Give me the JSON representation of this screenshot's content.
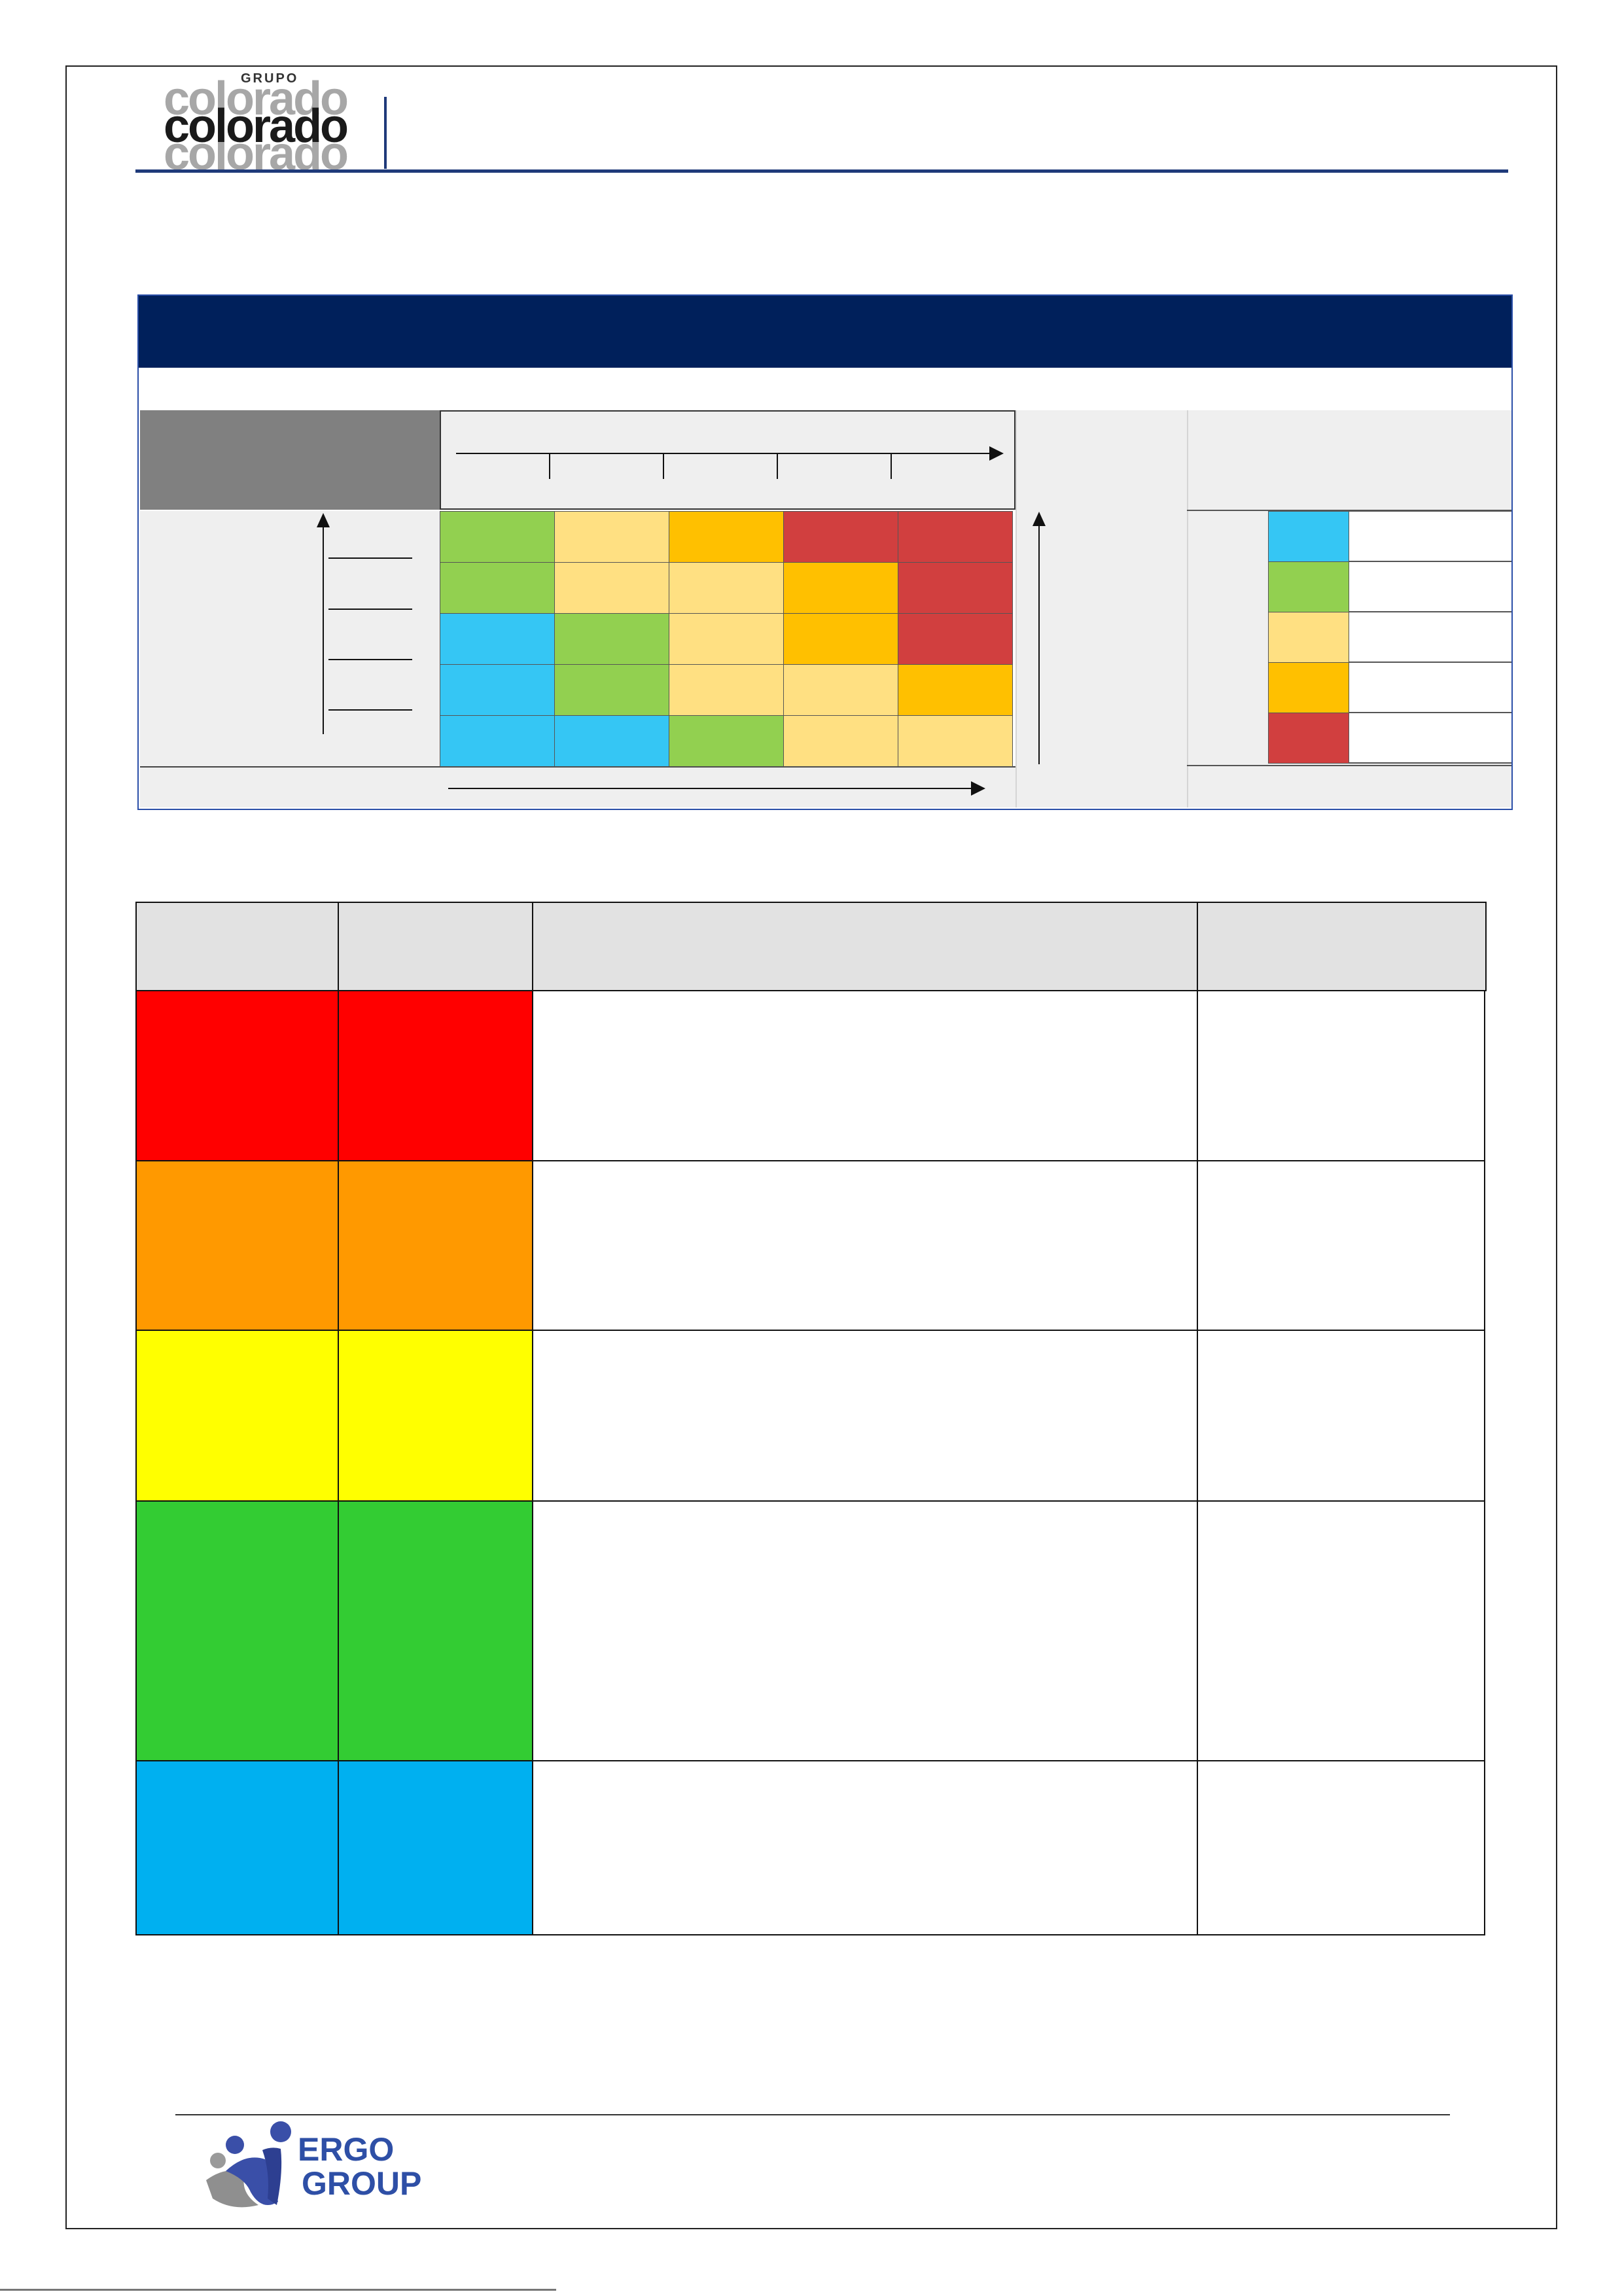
{
  "header": {
    "logo": {
      "grupo": "GRUPO",
      "line1": "colorado",
      "line2": "colorado",
      "line3": "colorado"
    }
  },
  "matrix": {
    "rows": [
      [
        "#92d050",
        "#ffe082",
        "#ffc000",
        "#d13f3f",
        "#d13f3f"
      ],
      [
        "#92d050",
        "#ffe082",
        "#ffe082",
        "#ffc000",
        "#d13f3f"
      ],
      [
        "#35c6f4",
        "#92d050",
        "#ffe082",
        "#ffc000",
        "#d13f3f"
      ],
      [
        "#35c6f4",
        "#92d050",
        "#ffe082",
        "#ffe082",
        "#ffc000"
      ],
      [
        "#35c6f4",
        "#35c6f4",
        "#92d050",
        "#ffe082",
        "#ffe082"
      ]
    ],
    "legend_colors": [
      "#35c6f4",
      "#92d050",
      "#ffe082",
      "#ffc000",
      "#d13f3f"
    ]
  },
  "risk_table": {
    "header_bg": "#e2e2e2",
    "row_colors": [
      "#ff0000",
      "#ff9900",
      "#ffff00",
      "#33cc33",
      "#00b0f0"
    ]
  },
  "footer": {
    "logo": {
      "line1": "ERGO",
      "line2": "GROUP"
    }
  }
}
